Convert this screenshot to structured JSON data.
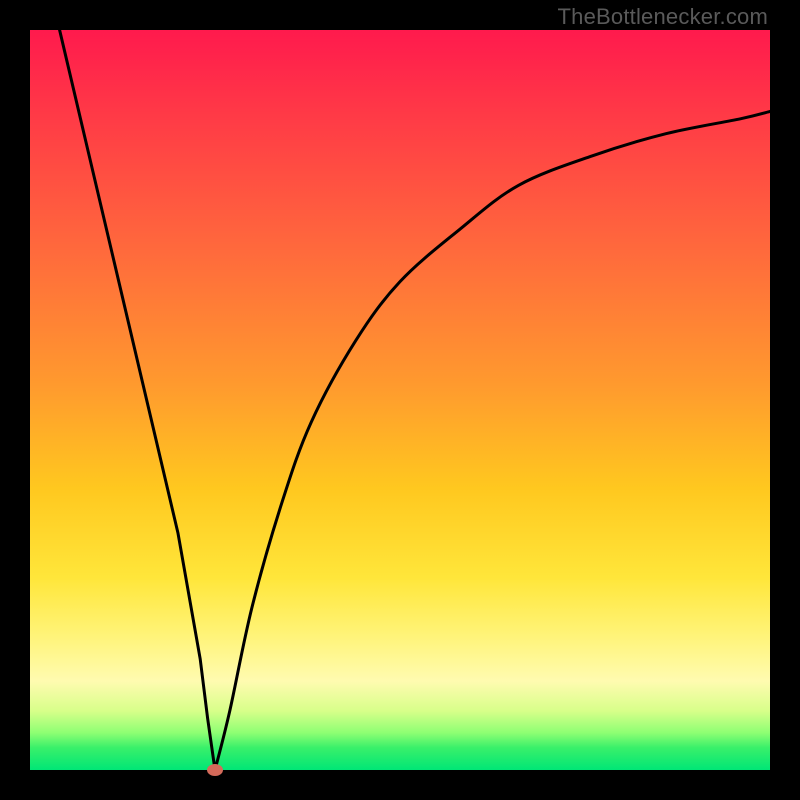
{
  "attribution": "TheBottlenecker.com",
  "marker": {
    "color": "#d46a5a",
    "rx": 8,
    "ry": 6
  },
  "curve": {
    "stroke": "#000000",
    "width": 3
  },
  "chart_data": {
    "type": "line",
    "title": "",
    "xlabel": "",
    "ylabel": "",
    "xlim": [
      0,
      100
    ],
    "ylim": [
      0,
      100
    ],
    "gradient_meaning": "vertical position maps to bottleneck severity (top=red=bad, bottom=green=good)",
    "series": [
      {
        "name": "left-branch",
        "x": [
          4,
          8,
          12,
          16,
          20,
          23,
          24,
          25
        ],
        "y": [
          100,
          83,
          66,
          49,
          32,
          15,
          7,
          0
        ]
      },
      {
        "name": "right-branch",
        "x": [
          25,
          27,
          30,
          34,
          38,
          44,
          50,
          58,
          66,
          76,
          86,
          96,
          100
        ],
        "y": [
          0,
          8,
          22,
          36,
          47,
          58,
          66,
          73,
          79,
          83,
          86,
          88,
          89
        ]
      }
    ],
    "marker_point": {
      "x": 25,
      "y": 0
    },
    "notes": "x,y are percentages of plot-area width/height; y=0 is bottom (green) and y=100 is top (red). Values estimated from pixels."
  }
}
